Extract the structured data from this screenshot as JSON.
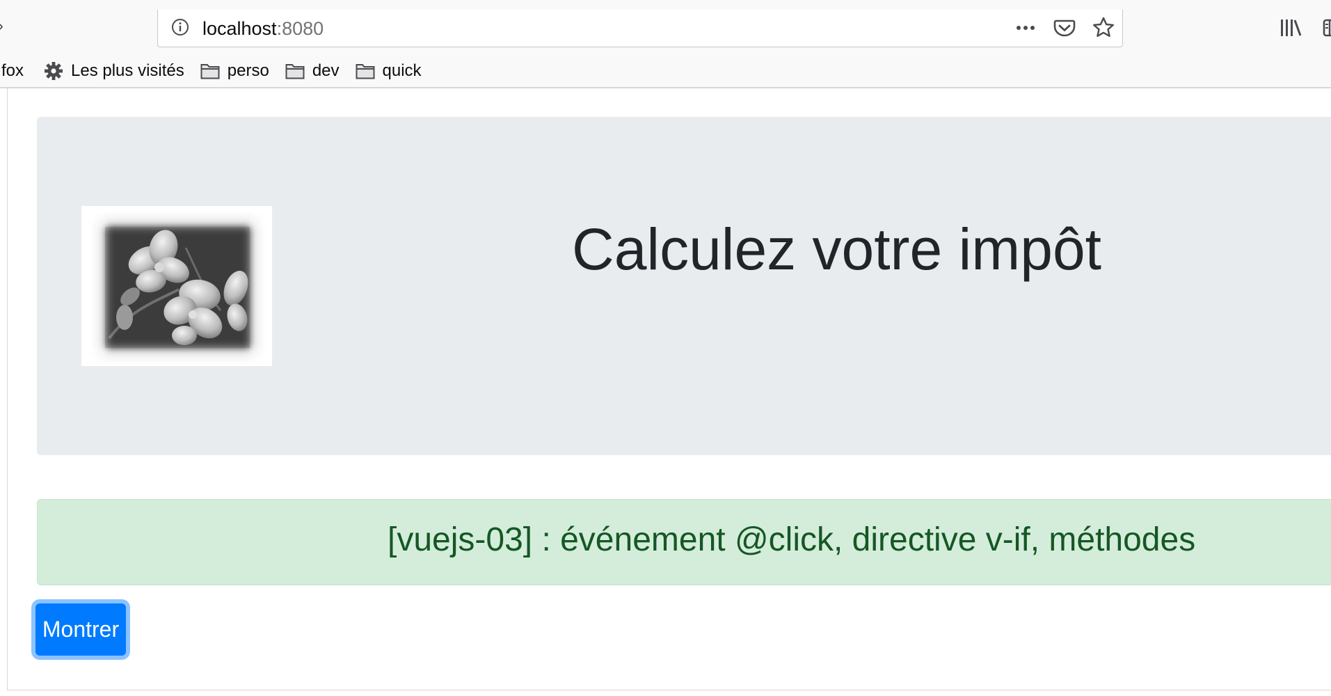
{
  "browser": {
    "bookmarks_toolbar": {
      "items": [
        {
          "label": "fox",
          "icon": "none"
        },
        {
          "label": "Les plus visités",
          "icon": "gear-icon"
        },
        {
          "label": "perso",
          "icon": "folder-icon"
        },
        {
          "label": "dev",
          "icon": "folder-icon"
        },
        {
          "label": "quick",
          "icon": "folder-icon"
        }
      ]
    },
    "urlbar": {
      "host": "localhost",
      "port": ":8080"
    }
  },
  "page": {
    "jumbotron": {
      "title": "Calculez votre impôt",
      "logo_icon": "flower-photo"
    },
    "alert": {
      "text": "[vuejs-03] : événement @click, directive v-if, méthodes"
    },
    "button": {
      "label": "Montrer"
    }
  },
  "colors": {
    "jumbotron_bg": "#e9ecef",
    "alert_bg": "#d4edda",
    "alert_text": "#155724",
    "primary": "#007bff"
  }
}
